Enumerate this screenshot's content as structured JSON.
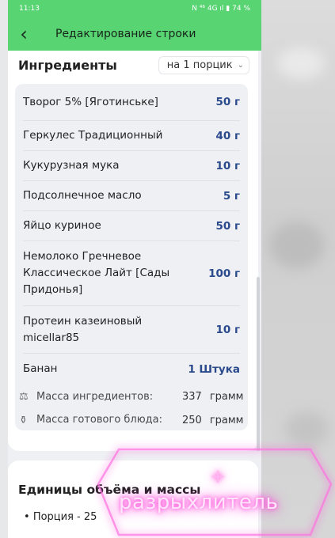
{
  "status_bar": {
    "time": "11:13",
    "icons": "N ⁴⁶ 4G ıl",
    "battery": "74 %"
  },
  "app_bar": {
    "back_icon": "‹",
    "title": "Редактирование строки"
  },
  "ingredients": {
    "title": "Ингредиенты",
    "portion_selector": "на 1 порцик",
    "items": [
      {
        "name": "Творог 5% [Яготинське]",
        "qty": "50 г"
      },
      {
        "name": "Геркулес Традиционный",
        "qty": "40 г"
      },
      {
        "name": "Кукурузная мука",
        "qty": "10 г"
      },
      {
        "name": "Подсолнечное масло",
        "qty": "5 г"
      },
      {
        "name": "Яйцо куриное",
        "qty": "50 г"
      },
      {
        "name": "Немолоко Гречневое Классическое Лайт [Сады Придонья]",
        "qty": "100 г"
      },
      {
        "name": "Протеин казеиновый micellar85",
        "qty": "10 г"
      },
      {
        "name": "Банан",
        "qty": "1 Штука"
      }
    ]
  },
  "mass": {
    "ingredients_label": "Масса ингредиентов:",
    "ingredients_value": "337",
    "ingredients_unit": "грамм",
    "dish_label": "Масса готового блюда:",
    "dish_value": "250",
    "dish_unit": "грамм"
  },
  "units": {
    "title": "Единицы объёма и массы",
    "portion_item": "Порция - 25"
  },
  "overlay": {
    "plus": "+",
    "text": "разрыхлитель"
  },
  "colors": {
    "accent_green": "#59d473",
    "qty_blue": "#2b4a8c",
    "neon_pink": "#ff4fd8"
  }
}
